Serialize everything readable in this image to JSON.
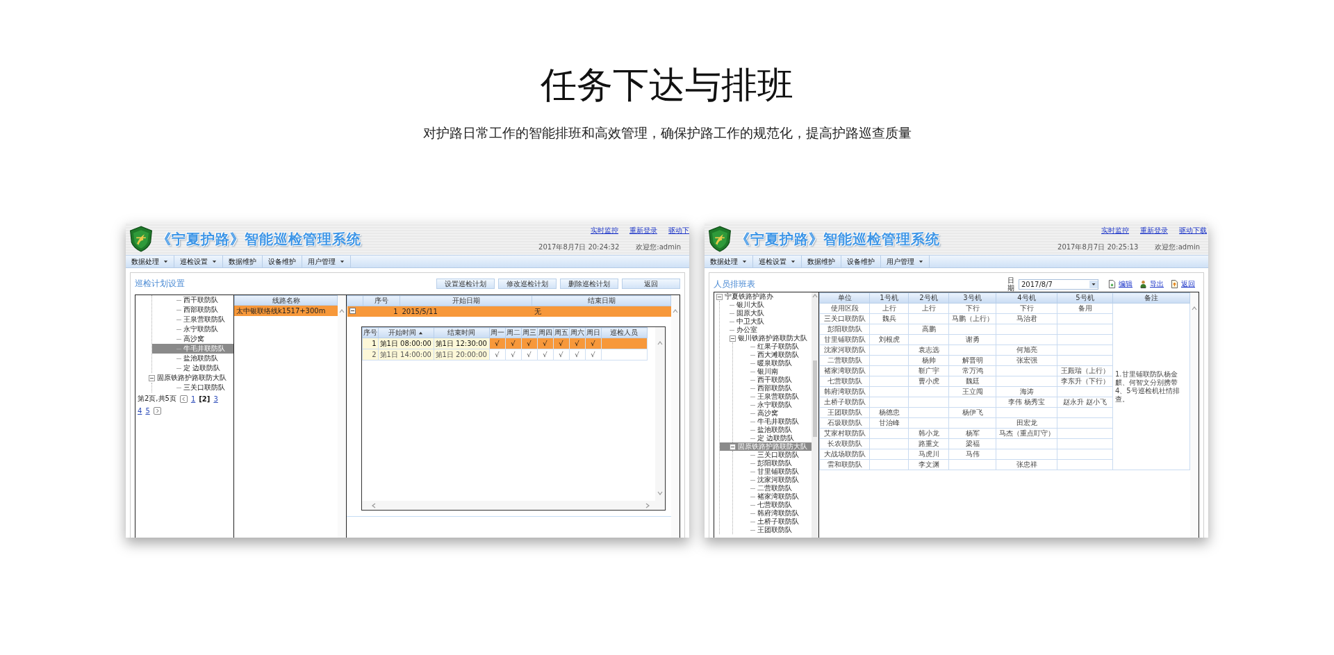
{
  "page": {
    "title": "任务下达与排班",
    "subtitle": "对护路日常工作的智能排班和高效管理，确保护路工作的规范化，提高护路巡查质量"
  },
  "plan_screen": {
    "header": {
      "system_title": "《宁夏护路》智能巡检管理系统",
      "links": [
        "实时监控",
        "重新登录",
        "驱动下"
      ],
      "datetime": "2017年8月7日 20:24:32",
      "welcome": "欢迎您:admin",
      "menu": [
        {
          "label": "数据处理",
          "dropdown": true
        },
        {
          "label": "巡检设置",
          "dropdown": true
        },
        {
          "label": "数据维护",
          "dropdown": false
        },
        {
          "label": "设备维护",
          "dropdown": false
        },
        {
          "label": "用户管理",
          "dropdown": true
        }
      ]
    },
    "section_title": "巡检计划设置",
    "buttons": [
      "设置巡检计划",
      "修改巡检计划",
      "删除巡检计划",
      "返回"
    ],
    "tree": [
      {
        "children": [
          {
            "label": "西干联防队",
            "selected": false
          },
          {
            "label": "西部联防队",
            "selected": false
          },
          {
            "label": "王泉营联防队",
            "selected": false
          },
          {
            "label": "永宁联防队",
            "selected": false
          },
          {
            "label": "高沙窝",
            "selected": false
          },
          {
            "label": "牛毛井联防队",
            "selected": true
          },
          {
            "label": "盐池联防队",
            "selected": false
          },
          {
            "label": "定 边联防队",
            "selected": false
          }
        ]
      },
      {
        "label": "固原铁路护路联防大队",
        "selected": false,
        "expanded": true,
        "children": [
          {
            "label": "三关口联防队",
            "selected": false
          }
        ]
      }
    ],
    "pager": {
      "summary": "第2页,共5页",
      "pages": [
        {
          "label": "1",
          "selected": false
        },
        {
          "label": "[2]",
          "selected": true
        },
        {
          "label": "3",
          "selected": false
        },
        {
          "label": "4",
          "selected": false
        },
        {
          "label": "5",
          "selected": false
        }
      ]
    },
    "routes": {
      "column": "线路名称",
      "rows": [
        {
          "name": "太中银联络线k1517+300m",
          "selected": true
        }
      ]
    },
    "plans": {
      "columns": [
        "序号",
        "开始日期",
        "结束日期"
      ],
      "rows": [
        {
          "index": "1",
          "start": "2015/5/11",
          "end": "无",
          "expanded": true,
          "selected": true
        }
      ]
    },
    "shifts": {
      "columns": [
        {
          "label": "序号"
        },
        {
          "label": "开始时间",
          "sorted": true
        },
        {
          "label": "结束时间"
        },
        {
          "label": "周一"
        },
        {
          "label": "周二"
        },
        {
          "label": "周三"
        },
        {
          "label": "周四"
        },
        {
          "label": "周五"
        },
        {
          "label": "周六"
        },
        {
          "label": "周日"
        },
        {
          "label": "巡检人员"
        }
      ],
      "rows": [
        {
          "index": "1",
          "start": "第1日 08:00:00",
          "end": "第1日 12:30:00",
          "days": [
            "√",
            "√",
            "√",
            "√",
            "√",
            "√",
            "√"
          ],
          "selected": true
        },
        {
          "index": "2",
          "start": "第1日 14:00:00",
          "end": "第1日 20:00:00",
          "days": [
            "√",
            "√",
            "√",
            "√",
            "√",
            "√",
            "√"
          ],
          "selected": false
        }
      ]
    }
  },
  "schedule_screen": {
    "header": {
      "system_title": "《宁夏护路》智能巡检管理系统",
      "links": [
        "实时监控",
        "重新登录",
        "驱动下载"
      ],
      "datetime": "2017年8月7日 20:25:13",
      "welcome": "欢迎您:admin",
      "menu": [
        {
          "label": "数据处理",
          "dropdown": true
        },
        {
          "label": "巡检设置",
          "dropdown": true
        },
        {
          "label": "数据维护",
          "dropdown": false
        },
        {
          "label": "设备维护",
          "dropdown": false
        },
        {
          "label": "用户管理",
          "dropdown": true
        }
      ]
    },
    "section_title": "人员排班表",
    "date_label": "日期",
    "date_value": "2017/8/7",
    "actions": [
      {
        "label": "编辑",
        "kind": "edit"
      },
      {
        "label": "导出",
        "kind": "export"
      },
      {
        "label": "返回",
        "kind": "back"
      }
    ],
    "tree": [
      {
        "label": "宁夏铁路护路办",
        "selected": false,
        "expanded": true,
        "children": [
          {
            "label": "银川大队",
            "selected": false
          },
          {
            "label": "固原大队",
            "selected": false
          },
          {
            "label": "中卫大队",
            "selected": false
          },
          {
            "label": "办公室",
            "selected": false
          },
          {
            "label": "银川铁路护路联防大队",
            "selected": false,
            "expanded": true,
            "children": [
              {
                "label": "红果子联防队",
                "selected": false
              },
              {
                "label": "西大滩联防队",
                "selected": false
              },
              {
                "label": "暖泉联防队",
                "selected": false
              },
              {
                "label": "银川南",
                "selected": false
              },
              {
                "label": "西干联防队",
                "selected": false
              },
              {
                "label": "西部联防队",
                "selected": false
              },
              {
                "label": "王泉营联防队",
                "selected": false
              },
              {
                "label": "永宁联防队",
                "selected": false
              },
              {
                "label": "高沙窝",
                "selected": false
              },
              {
                "label": "牛毛井联防队",
                "selected": false
              },
              {
                "label": "盐池联防队",
                "selected": false
              },
              {
                "label": "定 边联防队",
                "selected": false
              }
            ]
          },
          {
            "label": "固原铁路护路联防大队",
            "selected": true,
            "expanded": true,
            "children": [
              {
                "label": "三关口联防队",
                "selected": false
              },
              {
                "label": "彭阳联防队",
                "selected": false
              },
              {
                "label": "甘里铺联防队",
                "selected": false
              },
              {
                "label": "沈家河联防队",
                "selected": false
              },
              {
                "label": "二营联防队",
                "selected": false
              },
              {
                "label": "褚家湾联防队",
                "selected": false
              },
              {
                "label": "七营联防队",
                "selected": false
              },
              {
                "label": "韩府湾联防队",
                "selected": false
              },
              {
                "label": "土桥子联防队",
                "selected": false
              },
              {
                "label": "王团联防队",
                "selected": false
              }
            ]
          }
        ]
      }
    ],
    "table": {
      "columns": [
        "单位",
        "1号机",
        "2号机",
        "3号机",
        "4号机",
        "5号机",
        "备注"
      ],
      "rows": [
        {
          "unit": "使用区段",
          "machines": {
            "1": "上行",
            "2": "上行",
            "3": "下行",
            "4": "下行",
            "5": "备用"
          }
        },
        {
          "unit": "三关口联防队",
          "machines": {
            "1": "魏兵",
            "3": "马鹏（上行）",
            "4": "马治君"
          }
        },
        {
          "unit": "彭阳联防队",
          "machines": {
            "2": "高鹏"
          }
        },
        {
          "unit": "甘里铺联防队",
          "machines": {
            "1": "刘根虎",
            "3": "谢勇"
          }
        },
        {
          "unit": "沈家河联防队",
          "machines": {
            "2": "袁志选",
            "4": "何旭亮"
          }
        },
        {
          "unit": "二营联防队",
          "machines": {
            "2": "杨帅",
            "3": "解晋明",
            "4": "张宏强"
          }
        },
        {
          "unit": "褚家湾联防队",
          "machines": {
            "2": "靳广宇",
            "3": "常万鸿",
            "5": "王殿瑞（上行）"
          }
        },
        {
          "unit": "七营联防队",
          "machines": {
            "2": "曹小虎",
            "3": "魏廷",
            "5": "李东升（下行）"
          }
        },
        {
          "unit": "韩府湾联防队",
          "machines": {
            "3": "王立闯",
            "4": "海涛"
          }
        },
        {
          "unit": "土桥子联防队",
          "machines": {
            "4": "李伟 杨秀宝",
            "5": "赵永升 赵小飞"
          }
        },
        {
          "unit": "王团联防队",
          "machines": {
            "1": "杨德忠",
            "3": "杨伊飞"
          }
        },
        {
          "unit": "石圾联防队",
          "machines": {
            "1": "甘治峰",
            "4": "田宏龙"
          }
        },
        {
          "unit": "艾家村联防队",
          "machines": {
            "2": "韩小龙",
            "3": "杨军",
            "4": "马杰（重点盯守）"
          }
        },
        {
          "unit": "长农联防队",
          "machines": {
            "2": "路重文",
            "3": "梁福"
          }
        },
        {
          "unit": "大战场联防队",
          "machines": {
            "2": "马虎川",
            "3": "马伟"
          }
        },
        {
          "unit": "雷和联防队",
          "machines": {
            "2": "李文渊",
            "4": "张忠祥"
          }
        }
      ],
      "note": "1.甘里铺联防队杨金麒、何智文分别携带4、5号巡检机社情排查。"
    }
  }
}
